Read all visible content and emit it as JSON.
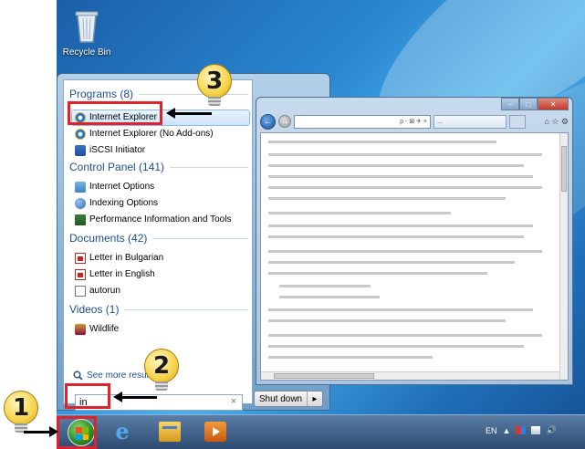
{
  "desktop": {
    "recycle_bin_label": "Recycle Bin"
  },
  "start_menu": {
    "groups": [
      {
        "heading": "Programs (8)",
        "items": [
          "Internet Explorer",
          "Internet Explorer (No Add-ons)",
          "iSCSI Initiator"
        ]
      },
      {
        "heading": "Control Panel (141)",
        "items": [
          "Internet Options",
          "Indexing Options",
          "Performance Information and Tools"
        ]
      },
      {
        "heading": "Documents (42)",
        "items": [
          "Letter in Bulgarian",
          "Letter in English",
          "autorun"
        ]
      },
      {
        "heading": "Videos (1)",
        "items": [
          "Wildlife"
        ]
      }
    ],
    "see_more": "See more results",
    "search_value": "in",
    "search_clear": "×",
    "shutdown_label": "Shut down",
    "shutdown_arrow": "▸"
  },
  "ie_window": {
    "caption_min": "–",
    "caption_max": "□",
    "caption_close": "✕",
    "back": "←",
    "forward": "→",
    "address_tools": "ρ - ⊠ ✈ ×",
    "tab_active": "...",
    "toolbar_icons": "⌂ ☆ ⚙"
  },
  "callouts": {
    "one": "1",
    "two": "2",
    "three": "3"
  },
  "tray": {
    "language": "EN",
    "up_arrow": "▲"
  }
}
